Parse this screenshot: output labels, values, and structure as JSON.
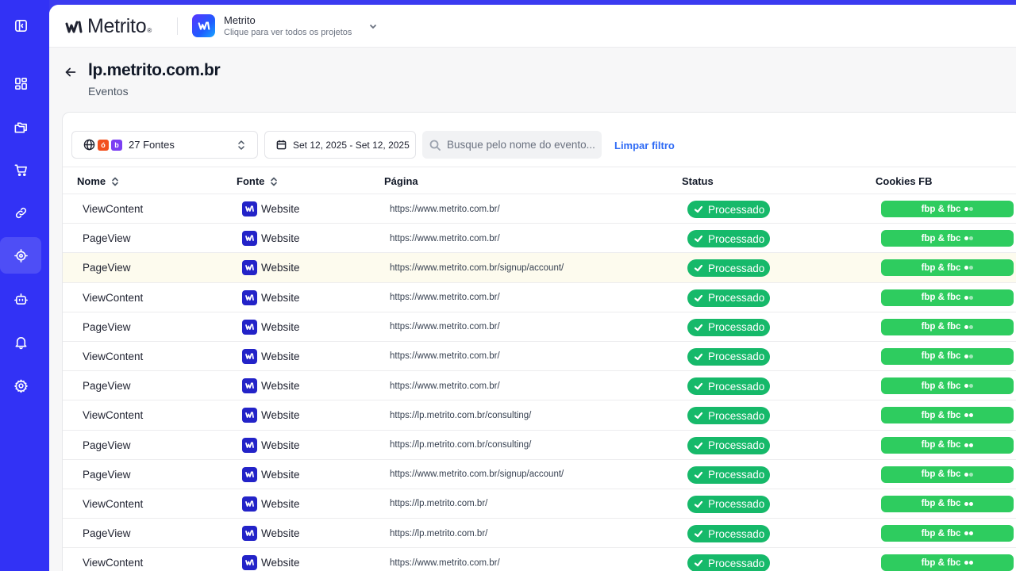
{
  "brand": {
    "name": "Metrito",
    "mark": "®"
  },
  "project": {
    "name": "Metrito",
    "subtitle": "Clique para ver todos os projetos"
  },
  "page": {
    "title": "lp.metrito.com.br",
    "subtitle": "Eventos"
  },
  "filters": {
    "fontes_label": "27 Fontes",
    "badge_o": "ó",
    "badge_b": "b",
    "date_range": "Set 12, 2025 - Set 12, 2025",
    "search_placeholder": "Busque pelo nome do evento...",
    "clear_label": "Limpar filtro"
  },
  "table": {
    "headers": {
      "name": "Nome",
      "source": "Fonte",
      "page": "Página",
      "status": "Status",
      "cookies": "Cookies FB"
    },
    "rows": [
      {
        "name": "ViewContent",
        "source": "Website",
        "page": "https://www.metrito.com.br/",
        "status": "Processado",
        "cookies": "fbp & fbc",
        "full": false
      },
      {
        "name": "PageView",
        "source": "Website",
        "page": "https://www.metrito.com.br/",
        "status": "Processado",
        "cookies": "fbp & fbc",
        "full": false
      },
      {
        "name": "PageView",
        "source": "Website",
        "page": "https://www.metrito.com.br/signup/account/",
        "status": "Processado",
        "cookies": "fbp & fbc",
        "full": false,
        "highlight": true
      },
      {
        "name": "ViewContent",
        "source": "Website",
        "page": "https://www.metrito.com.br/",
        "status": "Processado",
        "cookies": "fbp & fbc",
        "full": false
      },
      {
        "name": "PageView",
        "source": "Website",
        "page": "https://www.metrito.com.br/",
        "status": "Processado",
        "cookies": "fbp & fbc",
        "full": false
      },
      {
        "name": "ViewContent",
        "source": "Website",
        "page": "https://www.metrito.com.br/",
        "status": "Processado",
        "cookies": "fbp & fbc",
        "full": false
      },
      {
        "name": "PageView",
        "source": "Website",
        "page": "https://www.metrito.com.br/",
        "status": "Processado",
        "cookies": "fbp & fbc",
        "full": false
      },
      {
        "name": "ViewContent",
        "source": "Website",
        "page": "https://lp.metrito.com.br/consulting/",
        "status": "Processado",
        "cookies": "fbp & fbc",
        "full": true
      },
      {
        "name": "PageView",
        "source": "Website",
        "page": "https://lp.metrito.com.br/consulting/",
        "status": "Processado",
        "cookies": "fbp & fbc",
        "full": true
      },
      {
        "name": "PageView",
        "source": "Website",
        "page": "https://www.metrito.com.br/signup/account/",
        "status": "Processado",
        "cookies": "fbp & fbc",
        "full": false
      },
      {
        "name": "ViewContent",
        "source": "Website",
        "page": "https://lp.metrito.com.br/",
        "status": "Processado",
        "cookies": "fbp & fbc",
        "full": true
      },
      {
        "name": "PageView",
        "source": "Website",
        "page": "https://lp.metrito.com.br/",
        "status": "Processado",
        "cookies": "fbp & fbc",
        "full": true
      },
      {
        "name": "ViewContent",
        "source": "Website",
        "page": "https://www.metrito.com.br/",
        "status": "Processado",
        "cookies": "fbp & fbc",
        "full": true
      }
    ]
  },
  "colors": {
    "sidebar": "#3232f5",
    "status_green": "#16b96a",
    "cookie_green": "#2ecc5f",
    "link_blue": "#2f6bf5",
    "highlight_row": "#fdfbee"
  },
  "sidebar_icons": [
    "sidebar-toggle-icon",
    "dashboard-icon",
    "folders-icon",
    "cart-icon",
    "link-icon",
    "target-icon",
    "bot-icon",
    "bell-icon",
    "settings-icon"
  ]
}
